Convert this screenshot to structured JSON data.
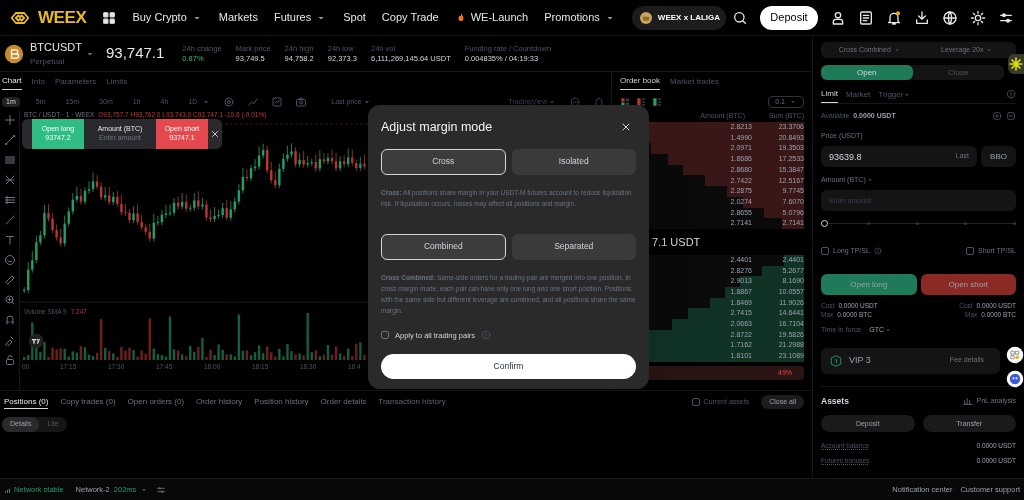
{
  "nav": {
    "logo": "WEEX",
    "items": [
      {
        "label": "Buy Crypto",
        "dropdown": true,
        "hot": false
      },
      {
        "label": "Markets",
        "dropdown": false,
        "hot": false
      },
      {
        "label": "Futures",
        "dropdown": true,
        "hot": false
      },
      {
        "label": "Spot",
        "dropdown": false,
        "hot": false
      },
      {
        "label": "Copy Trade",
        "dropdown": false,
        "hot": false
      },
      {
        "label": "WE-Launch",
        "dropdown": false,
        "hot": true
      },
      {
        "label": "Promotions",
        "dropdown": true,
        "hot": false
      }
    ],
    "badge": "WEEX x LALIGA",
    "deposit": "Deposit",
    "unread": true
  },
  "ticker": {
    "symbol": "BTCUSDT",
    "type": "Perpetual",
    "price": "93,747.1",
    "stats": [
      {
        "label": "24h change",
        "value": "0.87%",
        "kind": "up"
      },
      {
        "label": "Mark price",
        "value": "93,749.5",
        "kind": "plain"
      },
      {
        "label": "24h high",
        "value": "94,758.2",
        "kind": "plain"
      },
      {
        "label": "24h low",
        "value": "92,373.3",
        "kind": "plain"
      },
      {
        "label": "24h vol",
        "value": "6,111,269,145.64 USDT",
        "kind": "plain"
      },
      {
        "label": "Funding rate / Countdown",
        "value": "0.004835% / 04:19:33",
        "kind": "plain"
      }
    ]
  },
  "chart_tabs": [
    {
      "label": "Chart",
      "selected": true
    },
    {
      "label": "Info",
      "selected": false
    },
    {
      "label": "Parameters",
      "selected": false
    },
    {
      "label": "Limits",
      "selected": false
    }
  ],
  "intervals": [
    {
      "label": "1m",
      "selected": true
    },
    {
      "label": "5m",
      "selected": false
    },
    {
      "label": "15m",
      "selected": false
    },
    {
      "label": "30m",
      "selected": false
    },
    {
      "label": "1h",
      "selected": false
    },
    {
      "label": "4h",
      "selected": false
    },
    {
      "label": "1D",
      "selected": false
    }
  ],
  "price_type": "Last price",
  "chart_view": "TradingView",
  "legend": {
    "title": "BTC / USDT · 1 · WEEX",
    "ohlc": "O93,757.7 H93,762.0 L93,743.0 C93,747.1 -10.6 (-0.01%)"
  },
  "quick_trade": {
    "long_label": "Open long",
    "long_price": "93747.2",
    "amount_label": "Amount (BTC)",
    "amount_placeholder": "Enter amount",
    "short_label": "Open short",
    "short_price": "93747.1"
  },
  "volume": {
    "label": "Volume SMA 9",
    "value": "7.247"
  },
  "time_axis": [
    "00",
    "17:15",
    "17:30",
    "17:45",
    "18:00",
    "18:15",
    "18:30",
    "18:4"
  ],
  "order_book": {
    "tabs": [
      {
        "label": "Order book",
        "selected": true
      },
      {
        "label": "Market trades",
        "selected": false
      }
    ],
    "step": "0.1",
    "columns": [
      "Amount (BTC)",
      "Sum (BTC)"
    ],
    "asks": [
      {
        "amount": "2.8213",
        "sum": "23.3706",
        "level": 1.0
      },
      {
        "amount": "1.4990",
        "sum": "20.8493",
        "level": 0.89
      },
      {
        "amount": "2.0971",
        "sum": "19.3503",
        "level": 0.83
      },
      {
        "amount": "1.8686",
        "sum": "17.2533",
        "level": 0.74
      },
      {
        "amount": "2.8680",
        "sum": "15.3847",
        "level": 0.66
      },
      {
        "amount": "2.7422",
        "sum": "12.5167",
        "level": 0.54
      },
      {
        "amount": "2.2875",
        "sum": "9.7745",
        "level": 0.42
      },
      {
        "amount": "2.0274",
        "sum": "7.6070",
        "level": 0.33
      },
      {
        "amount": "2.8655",
        "sum": "5.0796",
        "level": 0.22
      },
      {
        "amount": "2.7141",
        "sum": "2.7141",
        "level": 0.12
      }
    ],
    "mid": "7.1 USDT",
    "bids": [
      {
        "amount": "2.4401",
        "sum": "2.4401",
        "level": 0.11
      },
      {
        "amount": "2.8276",
        "sum": "5.2677",
        "level": 0.23
      },
      {
        "amount": "2.9013",
        "sum": "8.1690",
        "level": 0.35
      },
      {
        "amount": "1.8867",
        "sum": "10.0557",
        "level": 0.43
      },
      {
        "amount": "1.8469",
        "sum": "11.9026",
        "level": 0.51
      },
      {
        "amount": "2.7415",
        "sum": "14.6441",
        "level": 0.63
      },
      {
        "amount": "2.0663",
        "sum": "16.7104",
        "level": 0.72
      },
      {
        "amount": "2.8722",
        "sum": "19.5826",
        "level": 0.84
      },
      {
        "amount": "1.7162",
        "sum": "21.2988",
        "level": 0.91
      },
      {
        "amount": "1.8101",
        "sum": "23.1089",
        "level": 0.99
      }
    ],
    "ratio": "49%"
  },
  "modal": {
    "title": "Adjust margin mode",
    "margin_options": [
      {
        "label": "Cross",
        "selected": true
      },
      {
        "label": "Isolated",
        "selected": false
      }
    ],
    "margin_note": "**Cross:** All positions share margin in your USDT-M futures account to reduce liquidation risk. If liquidation occurs, losses may affect all positions and margin.",
    "position_options": [
      {
        "label": "Combined",
        "selected": true
      },
      {
        "label": "Separated",
        "selected": false
      }
    ],
    "position_note": "**Cross Combined:** Same-side orders for a trading pair are merged into one position. In cross margin mode, each pair can have only one long and one short position. Positions with the same side but different leverage are combined, and all positions share the same margin.",
    "apply_all": {
      "label": "Apply to all trading pairs",
      "checked": false
    },
    "confirm": "Confirm"
  },
  "trade_panel": {
    "margin_mode": "Cross Combined",
    "leverage": "Leverage 20x",
    "sides": [
      {
        "label": "Open",
        "selected": true
      },
      {
        "label": "Close",
        "selected": false
      }
    ],
    "order_types": [
      {
        "label": "Limit",
        "selected": true,
        "dropdown": false
      },
      {
        "label": "Market",
        "selected": false,
        "dropdown": false
      },
      {
        "label": "Trigger",
        "selected": false,
        "dropdown": true
      }
    ],
    "available_label": "Available",
    "available": "0.0000 USDT",
    "price_label": "Price (USDT)",
    "price": "93639.8",
    "price_hint": "Last",
    "bbo": "BBO",
    "amount_label": "Amount (BTC)",
    "amount_placeholder": "Enter amount",
    "slider": {
      "level": 0
    },
    "tpsl": [
      {
        "label": "Long TP/SL",
        "checked": false
      },
      {
        "label": "Short TP/SL",
        "checked": false
      }
    ],
    "long": "Open long",
    "short": "Open short",
    "long_cost": {
      "cost_label": "Cost",
      "cost": "0.0000 USDT",
      "max_label": "Max",
      "max": "0.0000 BTC"
    },
    "short_cost": {
      "cost_label": "Cost",
      "cost": "0.0000 USDT",
      "max_label": "Max",
      "max": "0.0000 BTC"
    },
    "tif_label": "Time in force",
    "tif": "GTC",
    "vip": "VIP 3",
    "fee": "Fee details",
    "assets": "Assets",
    "pnl": "PnL analysis",
    "deposit": "Deposit",
    "transfer": "Transfer",
    "balances": [
      {
        "label": "Account balance",
        "value": "0.0000 USDT"
      },
      {
        "label": "Futures bonuses",
        "value": "0.0000 USDT"
      }
    ]
  },
  "bottom": {
    "tabs": [
      {
        "label": "Positions (0)",
        "selected": true
      },
      {
        "label": "Copy trades (0)",
        "selected": false
      },
      {
        "label": "Open orders (0)",
        "selected": false
      },
      {
        "label": "Order history",
        "selected": false
      },
      {
        "label": "Position history",
        "selected": false
      },
      {
        "label": "Order details",
        "selected": false
      },
      {
        "label": "Transaction history",
        "selected": false
      }
    ],
    "current_assets": {
      "label": "Current assets",
      "checked": false
    },
    "close_all": "Close all",
    "views": [
      {
        "label": "Details",
        "selected": true
      },
      {
        "label": "Lite",
        "selected": false
      }
    ]
  },
  "status_bar": {
    "network": "Network stable",
    "line": "Network-2",
    "latency": "202ms",
    "notifications": "Notification center",
    "support": "Customer support"
  }
}
